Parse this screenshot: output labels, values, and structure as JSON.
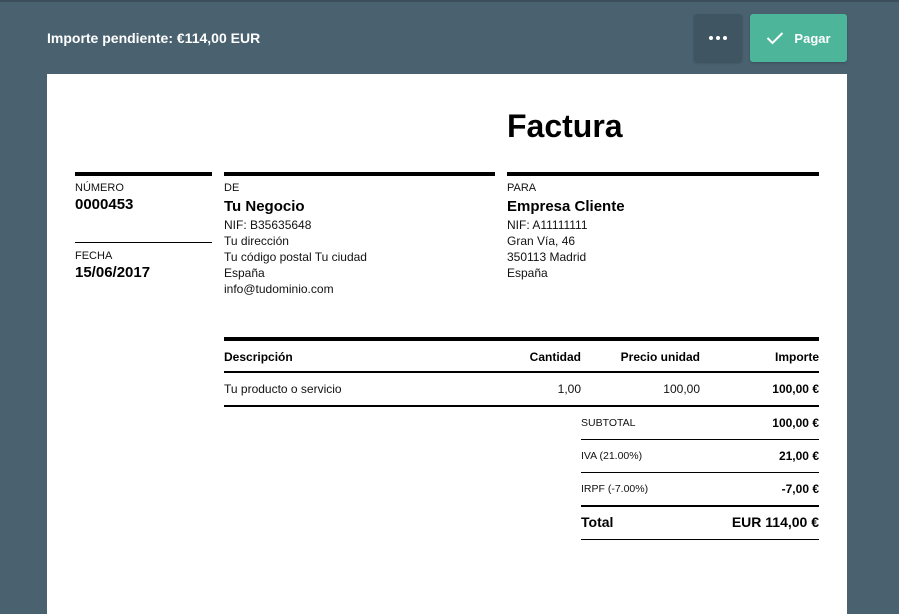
{
  "header": {
    "amount_due": "Importe pendiente: €114,00 EUR",
    "more_icon": "more-dots-icon",
    "pay_icon": "check-icon",
    "pay_label": "Pagar",
    "colors": {
      "bar": "#4a6170",
      "pay": "#4db59a",
      "more": "#3f5562"
    }
  },
  "invoice": {
    "title": "Factura",
    "number_label": "NÚMERO",
    "number": "0000453",
    "date_label": "FECHA",
    "date": "15/06/2017",
    "from": {
      "label": "DE",
      "name": "Tu Negocio",
      "tax_id": "NIF: B35635648",
      "address": "Tu dirección",
      "city": "Tu código postal Tu ciudad",
      "country": "España",
      "email": "info@tudominio.com"
    },
    "to": {
      "label": "PARA",
      "name": "Empresa Cliente",
      "tax_id": "NIF: A11111111",
      "address": "Gran Vía, 46",
      "city": "350113 Madrid",
      "country": "España"
    },
    "table": {
      "headers": [
        "Descripción",
        "Cantidad",
        "Precio unidad",
        "Importe"
      ],
      "rows": [
        [
          "Tu producto o servicio",
          "1,00",
          "100,00",
          "100,00 €"
        ]
      ]
    },
    "summary": {
      "subtotal_label": "SUBTOTAL",
      "subtotal": "100,00 €",
      "iva_label": "IVA (21.00%)",
      "iva": "21,00 €",
      "irpf_label": "IRPF (-7.00%)",
      "irpf": "-7,00 €",
      "total_label": "Total",
      "total": "EUR 114,00 €"
    }
  }
}
